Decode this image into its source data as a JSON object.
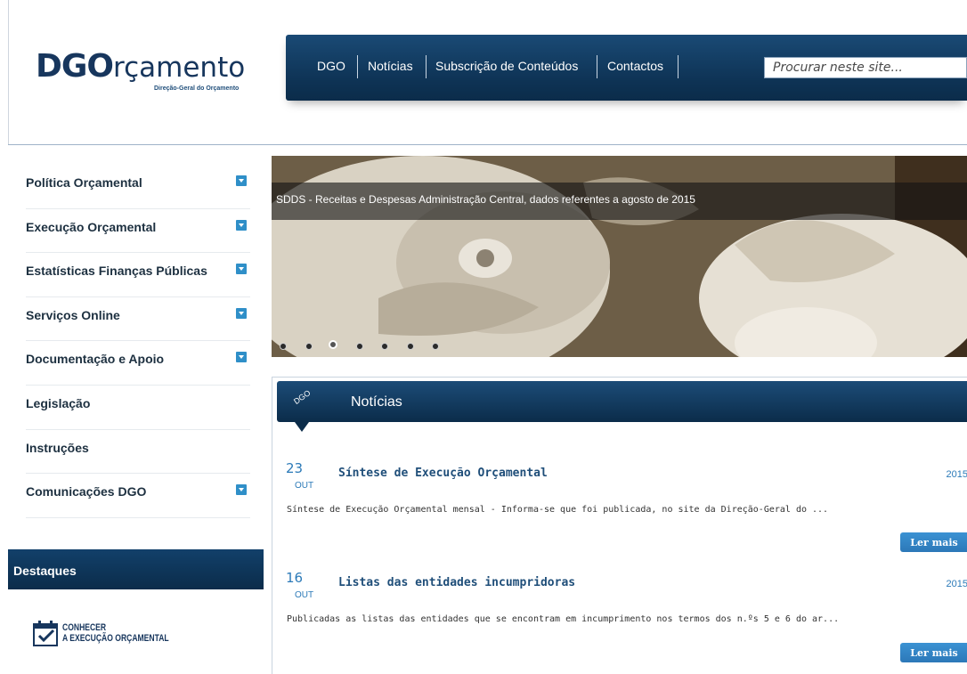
{
  "logo": {
    "main_prefix": "DGO",
    "main_suffix": "rçamento",
    "subtitle": "Direção-Geral do Orçamento"
  },
  "topnav": {
    "items": [
      "DGO",
      "Notícias",
      "Subscrição de Conteúdos",
      "Contactos"
    ],
    "search_placeholder": "Procurar neste site..."
  },
  "sidebar": {
    "items": [
      {
        "label": "Política Orçamental",
        "expandable": true
      },
      {
        "label": "Execução Orçamental",
        "expandable": true
      },
      {
        "label": "Estatísticas Finanças Públicas",
        "expandable": true
      },
      {
        "label": "Serviços Online",
        "expandable": true
      },
      {
        "label": "Documentação e Apoio",
        "expandable": true
      },
      {
        "label": "Legislação",
        "expandable": false
      },
      {
        "label": "Instruções",
        "expandable": false
      },
      {
        "label": "Comunicações DGO",
        "expandable": true
      }
    ],
    "highlights_title": "Destaques",
    "highlight_banner": {
      "line1": "CONHECER",
      "line2": "A EXECUÇÃO ORÇAMENTAL"
    }
  },
  "slider": {
    "caption": "SDDS - Receitas e Despesas Administração Central, dados referentes a agosto de 2015",
    "dot_count": 7,
    "active_dot": 3
  },
  "news": {
    "tag": "DGO",
    "title": "Notícias",
    "items": [
      {
        "day": "23",
        "month": "OUT",
        "title": "Síntese de Execução Orçamental",
        "year": "2015",
        "description": "Síntese de Execução Orçamental mensal  - Informa-se que foi publicada, no site da Direção-Geral do ...",
        "read_more": "Ler mais"
      },
      {
        "day": "16",
        "month": "OUT",
        "title": "Listas das entidades incumpridoras",
        "year": "2015",
        "description": "Publicadas as listas das entidades que se encontram em incumprimento nos termos dos n.ºs 5 e 6 do ar...",
        "read_more": "Ler mais"
      }
    ]
  },
  "colors": {
    "brand_navy": "#0e3355",
    "accent_blue": "#2c7ab8",
    "link_blue": "#1f4e79"
  }
}
